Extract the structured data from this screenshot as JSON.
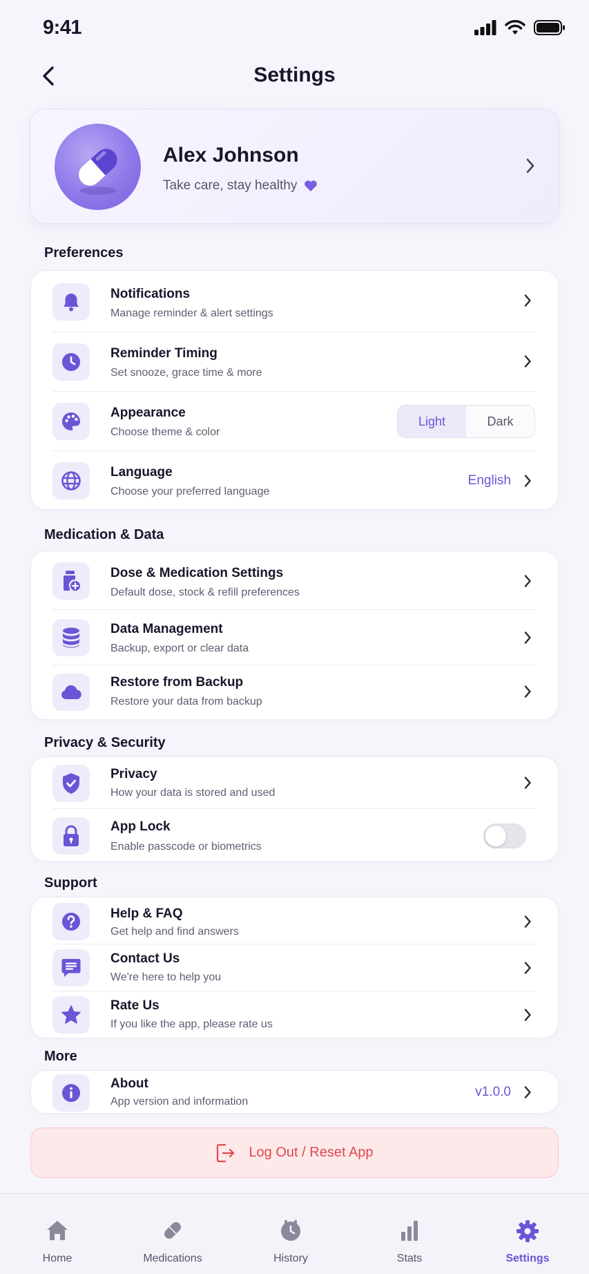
{
  "status_bar": {
    "time": "9:41"
  },
  "header": {
    "title": "Settings"
  },
  "profile": {
    "name": "Alex Johnson",
    "tagline": "Take care, stay healthy"
  },
  "sections": {
    "preferences": {
      "title": "Preferences",
      "notifications": {
        "title": "Notifications",
        "subtitle": "Manage reminder & alert settings"
      },
      "reminder_timing": {
        "title": "Reminder Timing",
        "subtitle": "Set snooze, grace time & more"
      },
      "appearance": {
        "title": "Appearance",
        "subtitle": "Choose theme & color",
        "options": [
          "Light",
          "Dark"
        ],
        "selected": "Light"
      },
      "language": {
        "title": "Language",
        "subtitle": "Choose your preferred language",
        "value": "English"
      }
    },
    "medication_data": {
      "title": "Medication & Data",
      "dose_settings": {
        "title": "Dose & Medication Settings",
        "subtitle": "Default dose, stock & refill preferences"
      },
      "data_management": {
        "title": "Data Management",
        "subtitle": "Backup, export or clear data"
      },
      "restore_backup": {
        "title": "Restore from Backup",
        "subtitle": "Restore your data from backup"
      }
    },
    "privacy_security": {
      "title": "Privacy & Security",
      "privacy": {
        "title": "Privacy",
        "subtitle": "How your data is stored and used"
      },
      "app_lock": {
        "title": "App Lock",
        "subtitle": "Enable passcode or biometrics",
        "enabled": false
      }
    },
    "support": {
      "title": "Support",
      "help_faq": {
        "title": "Help & FAQ",
        "subtitle": "Get help and find answers"
      },
      "contact_us": {
        "title": "Contact Us",
        "subtitle": "We're here to help you"
      },
      "rate_us": {
        "title": "Rate Us",
        "subtitle": "If you like the app, please rate us"
      }
    },
    "more": {
      "title": "More",
      "about": {
        "title": "About",
        "subtitle": "App version and information",
        "value": "v1.0.0"
      }
    }
  },
  "logout": {
    "label": "Log Out / Reset App"
  },
  "tab_bar": {
    "home": "Home",
    "medications": "Medications",
    "history": "History",
    "stats": "Stats",
    "settings": "Settings",
    "active": "Settings"
  },
  "colors": {
    "accent": "#6a55d6",
    "icon_bg": "#eeebfa",
    "danger": "#e2474d",
    "danger_bg": "#fde9ea",
    "background": "#f6f5fb"
  }
}
